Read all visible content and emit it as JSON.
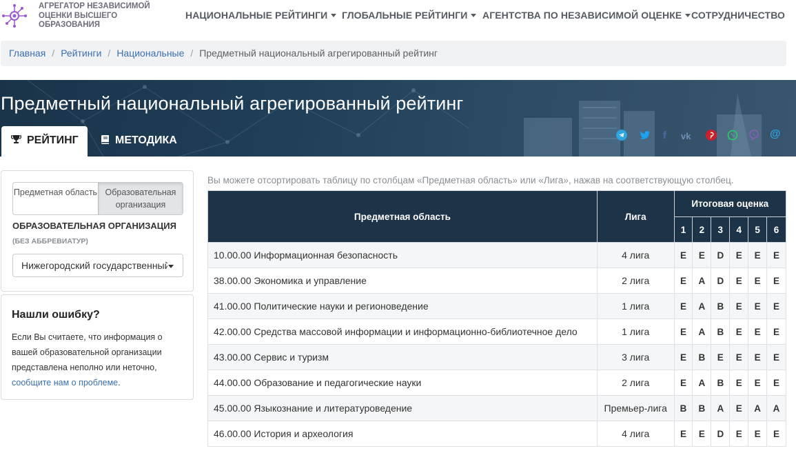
{
  "header": {
    "logo_text": "АГРЕГАТОР НЕЗАВИСИМОЙ ОЦЕНКИ ВЫСШЕГО ОБРАЗОВАНИЯ",
    "nav": [
      {
        "label": "НАЦИОНАЛЬНЫЕ РЕЙТИНГИ",
        "dropdown": true
      },
      {
        "label": "ГЛОБАЛЬНЫЕ РЕЙТИНГИ",
        "dropdown": true
      },
      {
        "label": "АГЕНТСТВА ПО НЕЗАВИСИМОЙ ОЦЕНКЕ",
        "dropdown": true
      },
      {
        "label": "СОТРУДНИЧЕСТВО",
        "dropdown": false
      }
    ]
  },
  "breadcrumb": {
    "items": [
      "Главная",
      "Рейтинги",
      "Национальные"
    ],
    "current": "Предметный национальный агрегированный рейтинг"
  },
  "hero": {
    "title": "Предметный национальный агрегированный рейтинг",
    "tabs": [
      {
        "label": "РЕЙТИНГ",
        "icon": "trophy-icon",
        "active": true
      },
      {
        "label": "МЕТОДИКА",
        "icon": "book-icon",
        "active": false
      }
    ],
    "share_icons": [
      "telegram-icon",
      "twitter-icon",
      "facebook-icon",
      "vk-icon",
      "pinterest-icon",
      "whatsapp-icon",
      "viber-icon",
      "email-icon"
    ]
  },
  "sidebar": {
    "toggle": [
      "Предметная область",
      "Образовательная организация"
    ],
    "toggle_active": 1,
    "org_title": "ОБРАЗОВАТЕЛЬНАЯ ОРГАНИЗАЦИЯ",
    "org_subtitle": "(БЕЗ АББРЕВИАТУР)",
    "org_select": "Нижегородский государственный университет",
    "error_title": "Нашли ошибку?",
    "error_text": "Если Вы считаете, что информация о вашей образовательной организации представлена неполно или неточно,",
    "error_link": "сообщите нам о проблеме",
    "error_tail": "."
  },
  "table": {
    "hint": "Вы можете отсортировать таблицу по столбцам «Предметная область» или «Лига», нажав на соответствующую столбец.",
    "col_subject": "Предметная область",
    "col_league": "Лига",
    "col_final": "Итоговая оценка",
    "grade_cols": [
      "1",
      "2",
      "3",
      "4",
      "5",
      "6"
    ],
    "rows": [
      {
        "subject": "10.00.00 Информационная безопасность",
        "league": "4 лига",
        "grades": [
          "E",
          "E",
          "D",
          "E",
          "E",
          "E"
        ],
        "active": [
          true,
          true,
          true,
          false,
          false,
          false
        ]
      },
      {
        "subject": "38.00.00 Экономика и управление",
        "league": "2 лига",
        "grades": [
          "E",
          "A",
          "D",
          "E",
          "E",
          "E"
        ],
        "active": [
          true,
          true,
          true,
          false,
          false,
          false
        ]
      },
      {
        "subject": "41.00.00 Политические науки и регионоведение",
        "league": "1 лига",
        "grades": [
          "E",
          "A",
          "B",
          "E",
          "E",
          "E"
        ],
        "active": [
          true,
          true,
          true,
          false,
          false,
          false
        ]
      },
      {
        "subject": "42.00.00 Средства массовой информации и информационно-библиотечное дело",
        "league": "1 лига",
        "grades": [
          "E",
          "A",
          "B",
          "E",
          "E",
          "E"
        ],
        "active": [
          true,
          true,
          true,
          false,
          false,
          false
        ]
      },
      {
        "subject": "43.00.00 Сервис и туризм",
        "league": "3 лига",
        "grades": [
          "E",
          "B",
          "E",
          "E",
          "E",
          "E"
        ],
        "active": [
          true,
          true,
          true,
          false,
          false,
          false
        ]
      },
      {
        "subject": "44.00.00 Образование и педагогические науки",
        "league": "2 лига",
        "grades": [
          "E",
          "A",
          "B",
          "E",
          "E",
          "E"
        ],
        "active": [
          true,
          true,
          true,
          false,
          false,
          false
        ]
      },
      {
        "subject": "45.00.00 Языкознание и литературоведение",
        "league": "Премьер-лига",
        "grades": [
          "B",
          "B",
          "A",
          "E",
          "A",
          "A"
        ],
        "active": [
          false,
          false,
          true,
          false,
          true,
          true
        ]
      },
      {
        "subject": "46.00.00 История и археология",
        "league": "4 лига",
        "grades": [
          "E",
          "E",
          "D",
          "E",
          "E",
          "E"
        ],
        "active": [
          true,
          true,
          true,
          false,
          false,
          false
        ]
      }
    ]
  },
  "colors": {
    "header_bg": "#1d3347",
    "link": "#3a6fb0",
    "grade_active": "#3a75c4",
    "grade_muted": "#a9adb2"
  }
}
